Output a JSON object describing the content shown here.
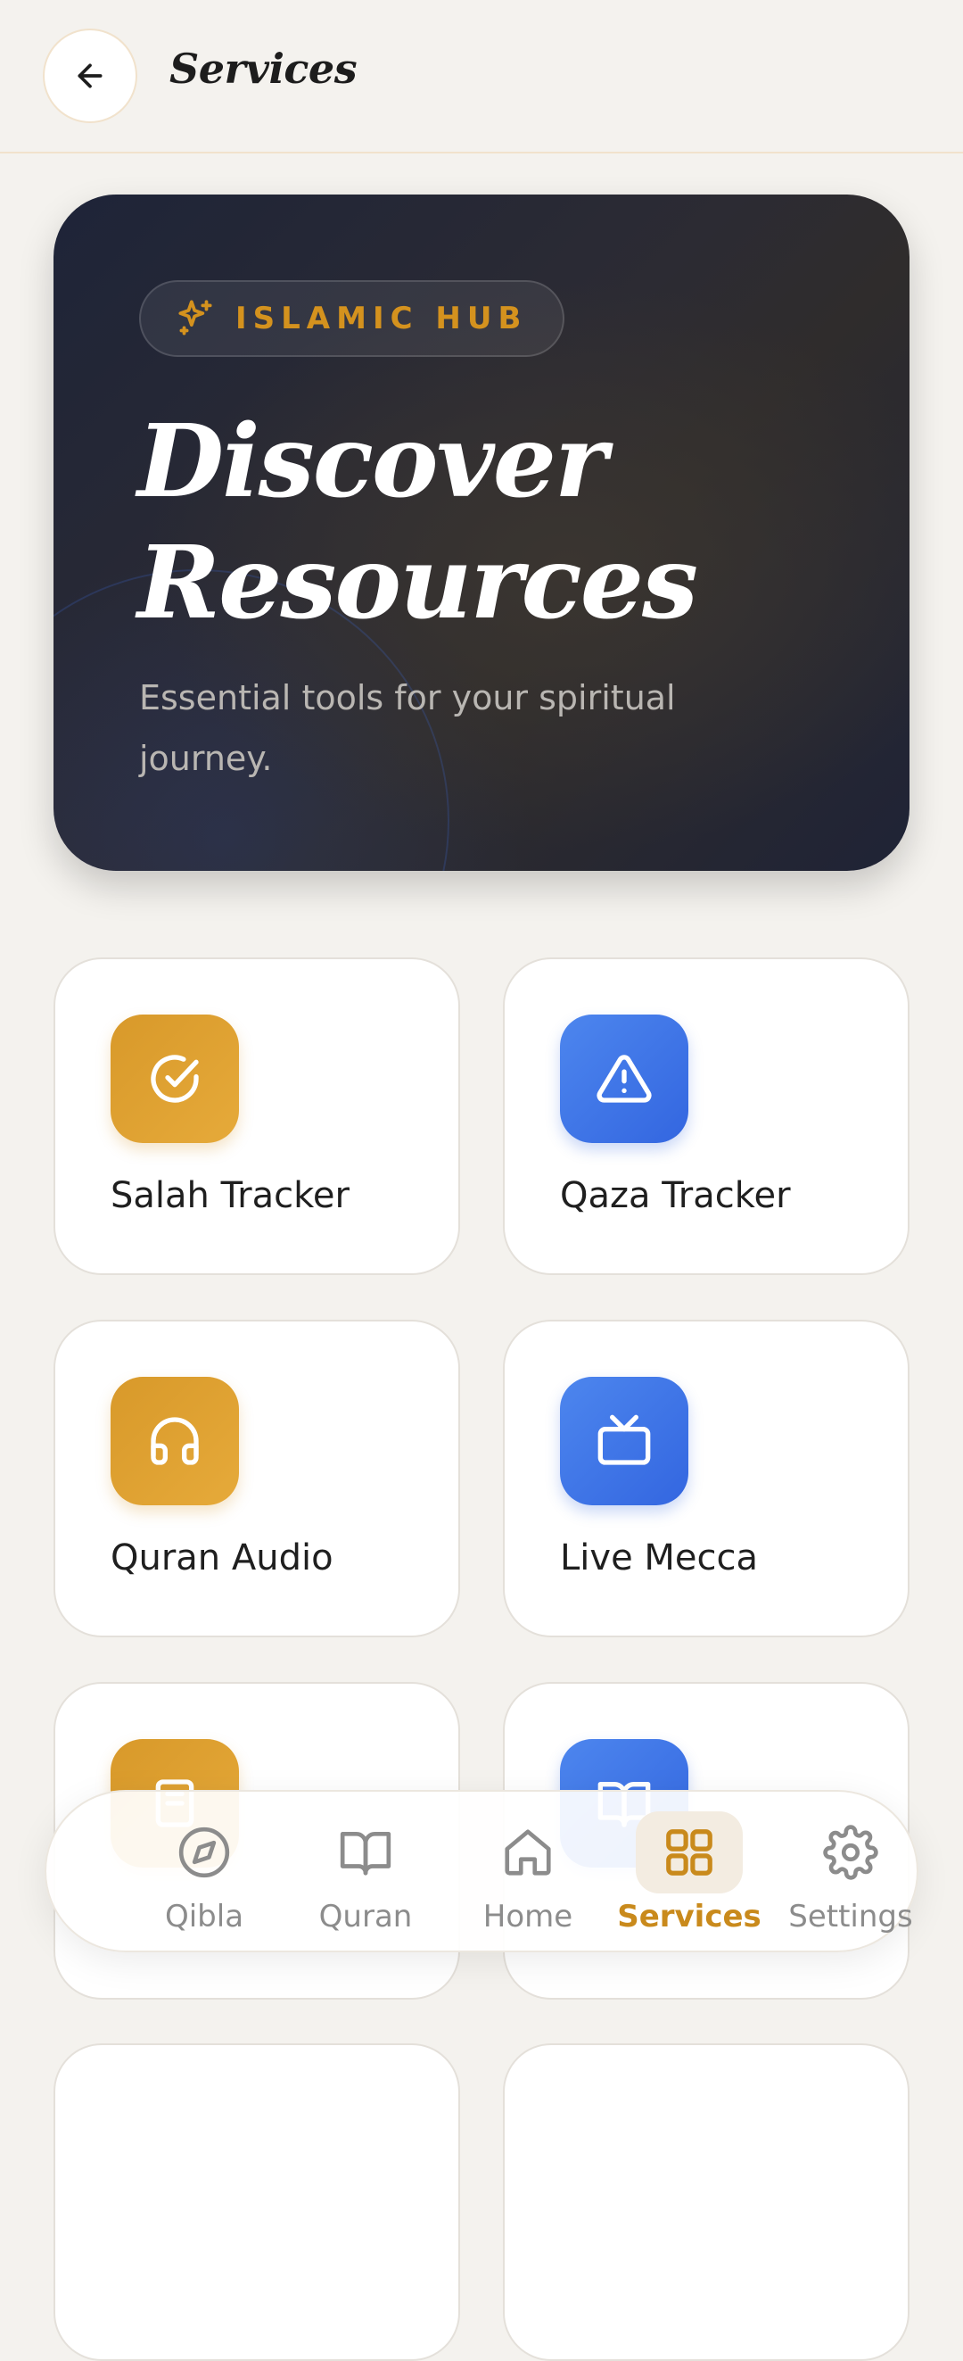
{
  "header": {
    "title": "Services",
    "back_icon": "arrow-left-icon"
  },
  "hero": {
    "badge_icon": "sparkles-icon",
    "badge_label": "ISLAMIC HUB",
    "title_line1": "Discover",
    "title_line2": "Resources",
    "subtitle": "Essential tools for your spiritual journey."
  },
  "services": [
    {
      "label": "Salah Tracker",
      "icon": "check-circle-icon",
      "color": "gold"
    },
    {
      "label": "Qaza Tracker",
      "icon": "warning-triangle-icon",
      "color": "blue"
    },
    {
      "label": "Quran Audio",
      "icon": "headphones-icon",
      "color": "gold"
    },
    {
      "label": "Live Mecca",
      "icon": "tv-icon",
      "color": "blue"
    }
  ],
  "nav": {
    "items": [
      {
        "label": "Qibla",
        "icon": "compass-icon"
      },
      {
        "label": "Quran",
        "icon": "book-open-icon"
      },
      {
        "label": "Home",
        "icon": "home-icon"
      },
      {
        "label": "Services",
        "icon": "grid-icon",
        "active": true
      },
      {
        "label": "Settings",
        "icon": "gear-icon"
      }
    ]
  },
  "colors": {
    "accent_gold": "#d8992a",
    "accent_blue": "#3f78e8",
    "background": "#f4f2ee",
    "hero_dark": "#2a2a30"
  }
}
